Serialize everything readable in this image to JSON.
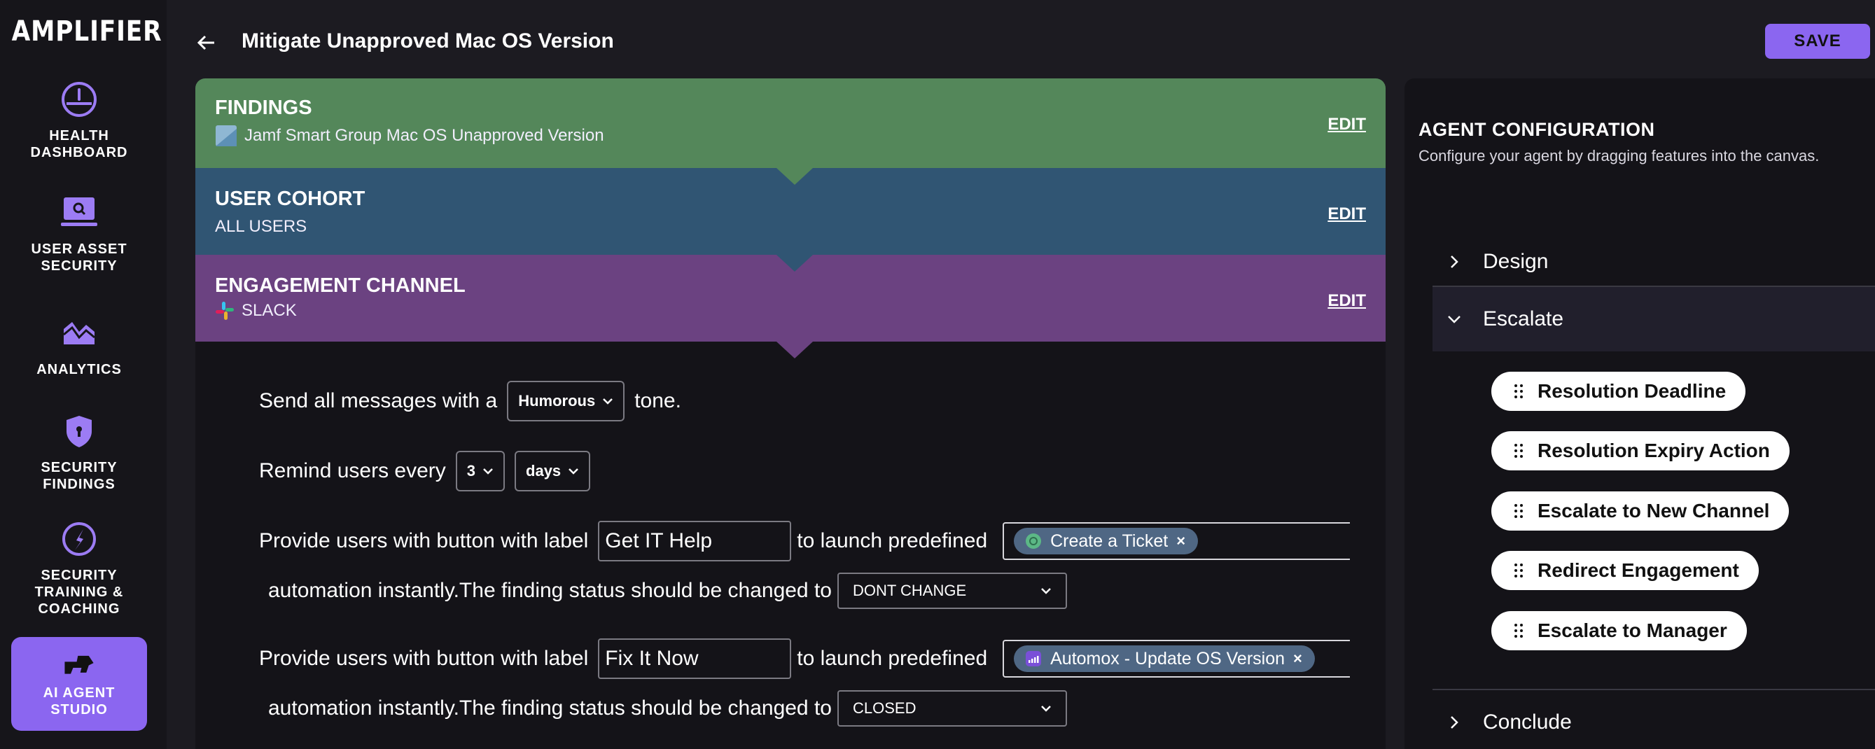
{
  "app": {
    "brand": "AMPLIFIER"
  },
  "sidebar": {
    "items": [
      {
        "label": "HEALTH DASHBOARD",
        "icon": "gauge-icon"
      },
      {
        "label": "USER ASSET SECURITY",
        "icon": "laptop-search-icon"
      },
      {
        "label": "ANALYTICS",
        "icon": "chart-mountain-icon"
      },
      {
        "label": "SECURITY FINDINGS",
        "icon": "shield-icon"
      },
      {
        "label": "SECURITY TRAINING & COACHING",
        "icon": "compass-icon"
      },
      {
        "label": "AI AGENT STUDIO",
        "icon": "agent-icon",
        "active": true
      }
    ]
  },
  "header": {
    "title": "Mitigate Unapproved Mac OS Version",
    "save_label": "SAVE"
  },
  "bands": {
    "findings": {
      "title": "FINDINGS",
      "subtitle": "Jamf Smart Group Mac OS Unapproved Version",
      "edit": "EDIT",
      "color": "#54875a"
    },
    "cohort": {
      "title": "USER COHORT",
      "subtitle": "ALL USERS",
      "edit": "EDIT",
      "color": "#305573"
    },
    "channel": {
      "title": "ENGAGEMENT CHANNEL",
      "subtitle": "SLACK",
      "edit": "EDIT",
      "color": "#6b4281"
    }
  },
  "canvas": {
    "tone_prefix": "Send all messages with a",
    "tone_value": "Humorous",
    "tone_suffix": "tone.",
    "remind_prefix": "Remind users every",
    "remind_count": "3",
    "remind_unit": "days",
    "actions": [
      {
        "prefix": "Provide users with button with label",
        "label_value": "Get IT Help",
        "middle": "to launch predefined",
        "chip": "Create a Ticket",
        "line2": "automation instantly.The finding status should be changed to",
        "status": "DONT CHANGE"
      },
      {
        "prefix": "Provide users with button with label",
        "label_value": "Fix It Now",
        "middle": "to launch predefined",
        "chip": "Automox - Update OS Version",
        "line2": "automation instantly.The finding status should be changed to",
        "status": "CLOSED"
      }
    ]
  },
  "config": {
    "title": "AGENT CONFIGURATION",
    "subtitle": "Configure your agent by dragging features into the canvas.",
    "sections": {
      "design": "Design",
      "escalate": "Escalate",
      "conclude": "Conclude"
    },
    "escalate_items": [
      "Resolution Deadline",
      "Resolution Expiry Action",
      "Escalate to New Channel",
      "Redirect Engagement",
      "Escalate to Manager"
    ]
  },
  "colors": {
    "accent": "#8b66f0",
    "chip": "#4f6784"
  }
}
